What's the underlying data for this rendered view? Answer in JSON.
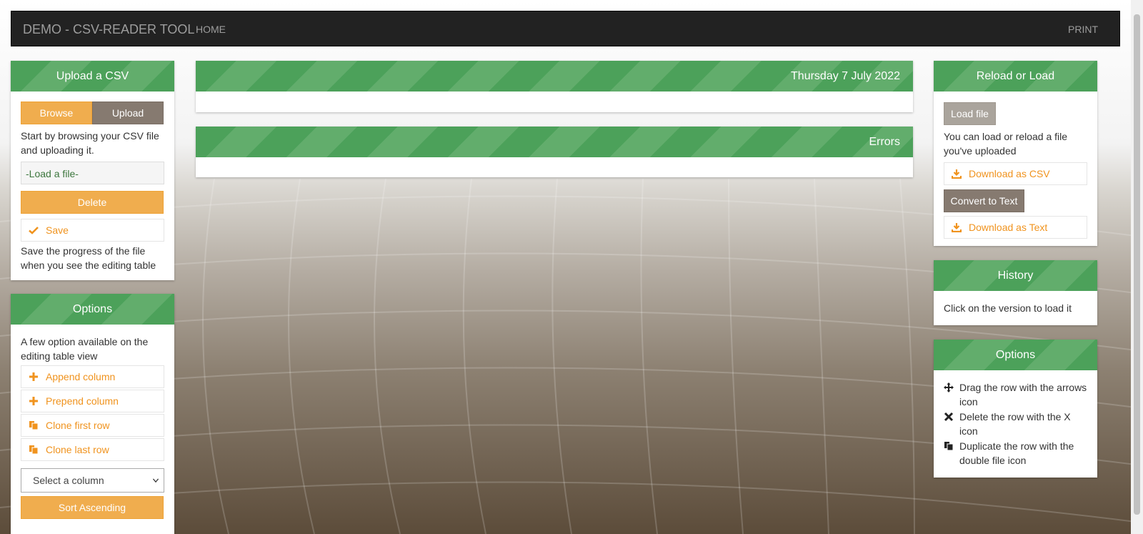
{
  "navbar": {
    "brand": "DEMO - CSV-READER TOOL",
    "home": "HOME",
    "print": "PRINT"
  },
  "upload_panel": {
    "title": "Upload a CSV",
    "browse": "Browse",
    "upload": "Upload",
    "intro": "Start by browsing your CSV file and uploading it.",
    "file_field": "-Load a file-",
    "delete": "Delete",
    "save": "Save",
    "save_text": "Save the progress of the file when you see the editing table"
  },
  "options_left": {
    "title": "Options",
    "intro": "A few option available on the editing table view",
    "items": [
      "Append column",
      "Prepend column",
      "Clone first row",
      "Clone last row"
    ],
    "select": "Select a column",
    "sort": "Sort Ascending"
  },
  "date_panel": {
    "title": "Thursday 7 July 2022"
  },
  "errors_panel": {
    "title": "Errors"
  },
  "reload_panel": {
    "title": "Reload or Load",
    "load_file": "Load file",
    "text": "You can load or reload a file you've uploaded",
    "download_csv": "Download as CSV",
    "convert": "Convert to Text",
    "download_text": "Download as Text"
  },
  "history_panel": {
    "title": "History",
    "text": "Click on the version to load it"
  },
  "options_right": {
    "title": "Options",
    "items": [
      "Drag the row with the arrows icon",
      "Delete the row with the X icon",
      "Duplicate the row with the double file icon"
    ]
  },
  "colors": {
    "green": "#4ca15a",
    "orange": "#f0ad4e",
    "brown": "#867a70",
    "navbar": "#222222"
  }
}
